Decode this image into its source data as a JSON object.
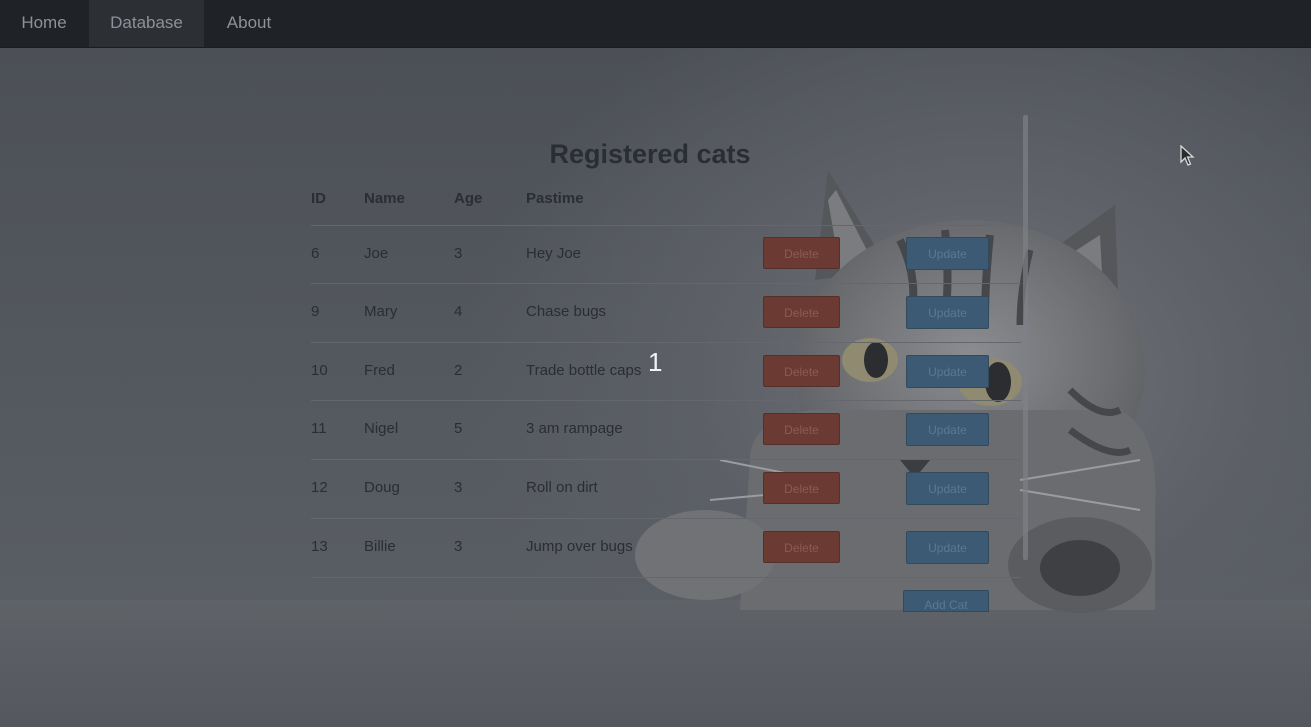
{
  "nav": {
    "items": [
      {
        "label": "Home"
      },
      {
        "label": "Database"
      },
      {
        "label": "About"
      }
    ],
    "active": "Database"
  },
  "main": {
    "title": "Registered cats",
    "columns": [
      "ID",
      "Name",
      "Age",
      "Pastime"
    ],
    "rows": [
      {
        "id": "6",
        "name": "Joe",
        "age": "3",
        "pastime": "Hey Joe"
      },
      {
        "id": "9",
        "name": "Mary",
        "age": "4",
        "pastime": "Chase bugs"
      },
      {
        "id": "10",
        "name": "Fred",
        "age": "2",
        "pastime": "Trade bottle caps"
      },
      {
        "id": "11",
        "name": "Nigel",
        "age": "5",
        "pastime": "3 am rampage"
      },
      {
        "id": "12",
        "name": "Doug",
        "age": "3",
        "pastime": "Roll on dirt"
      },
      {
        "id": "13",
        "name": "Billie",
        "age": "3",
        "pastime": "Jump over bugs"
      }
    ],
    "delete_label": "Delete",
    "update_label": "Update",
    "add_label": "Add Cat"
  },
  "overlay": {
    "number": "1"
  },
  "colors": {
    "navbar": "#1f2226",
    "delete": "#6b3a33",
    "update": "#3c5a74"
  },
  "icons": [
    "mouse-cursor-icon",
    "cat-illustration"
  ]
}
